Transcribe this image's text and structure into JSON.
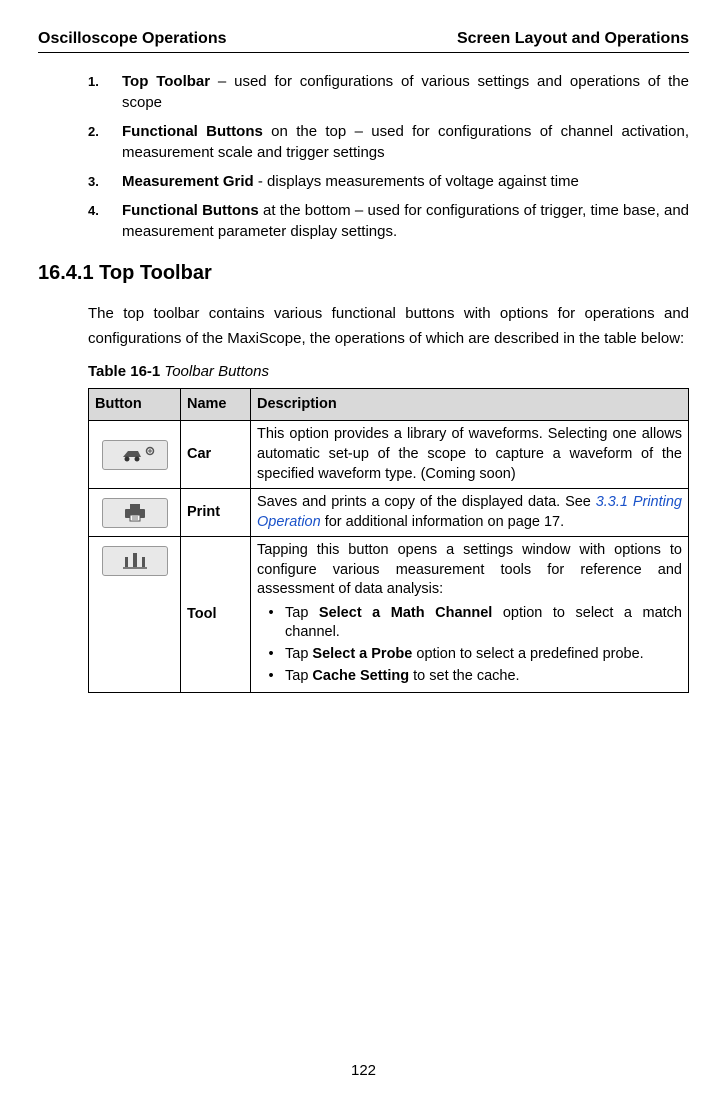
{
  "header": {
    "left": "Oscilloscope Operations",
    "right": "Screen Layout and Operations"
  },
  "list": {
    "items": [
      {
        "num": "1.",
        "bold": "Top Toolbar",
        "rest": " – used for configurations of various settings and operations of the scope"
      },
      {
        "num": "2.",
        "bold": "Functional Buttons",
        "rest": " on the top – used for configurations of channel activation, measurement scale and trigger settings"
      },
      {
        "num": "3.",
        "bold": "Measurement Grid",
        "rest": " - displays measurements of voltage against time"
      },
      {
        "num": "4.",
        "bold": "Functional Buttons",
        "rest": " at the bottom – used for configurations of trigger, time base, and measurement parameter display settings."
      }
    ]
  },
  "section": {
    "heading": "16.4.1 Top Toolbar",
    "para": "The top toolbar contains various functional buttons with options for operations and configurations of the MaxiScope, the operations of which are described in the table below:"
  },
  "table": {
    "caption_bold": "Table 16-1",
    "caption_italic": " Toolbar Buttons",
    "headers": {
      "button": "Button",
      "name": "Name",
      "description": "Description"
    },
    "rows": {
      "car": {
        "name": "Car",
        "desc": "This option provides a library of waveforms. Selecting one allows automatic set-up of the scope to capture a waveform of the specified waveform type. (Coming soon)"
      },
      "print": {
        "name": "Print",
        "desc_prefix": "Saves and prints a copy of the displayed data. See ",
        "desc_link": "3.3.1 Printing Operation",
        "desc_suffix": " for additional information on page 17."
      },
      "tool": {
        "name": "Tool",
        "intro": "Tapping this button opens a settings window with options to configure various measurement tools for reference and assessment of data analysis:",
        "bullets": [
          {
            "pre": "Tap ",
            "bold": "Select a Math Channel",
            "post": " option to select a match channel."
          },
          {
            "pre": "Tap ",
            "bold": "Select a Probe",
            "post": " option to select a predefined probe."
          },
          {
            "pre": "Tap ",
            "bold": "Cache Setting",
            "post": " to set the cache."
          }
        ]
      }
    }
  },
  "page_number": "122"
}
